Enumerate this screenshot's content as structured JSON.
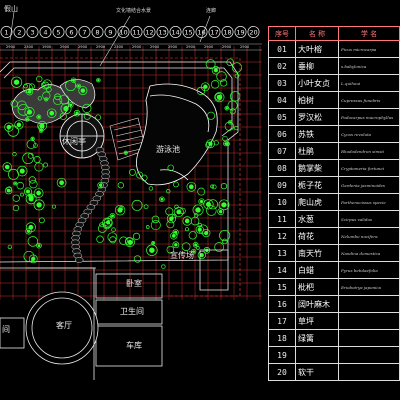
{
  "header": {
    "left_label": "假山",
    "center_label": "文化墙结合水景",
    "right_label": "连廊"
  },
  "axis": {
    "numbers": [
      "1",
      "2",
      "3",
      "4",
      "5",
      "6",
      "7",
      "8",
      "9",
      "10",
      "11",
      "12",
      "13",
      "14",
      "15",
      "16",
      "17",
      "18",
      "19",
      "20"
    ],
    "dimensions": [
      "2900",
      "2300",
      "1900",
      "2900",
      "2900",
      "2900",
      "2300",
      "2900",
      "2900",
      "2900",
      "2900",
      "2900",
      "2900",
      "2900"
    ]
  },
  "plan_labels": {
    "pavilion": "休闲亭",
    "pool": "游泳池",
    "plaza": "宣传场",
    "room1": "卧室",
    "room2": "卫生间",
    "living": "客厅",
    "garage": "车库",
    "corner": "间"
  },
  "legend": {
    "headers": [
      "序号",
      "名 称",
      "学 名"
    ],
    "rows": [
      {
        "no": "01",
        "name": "大叶榕",
        "sci": "Ficus microcarpa"
      },
      {
        "no": "02",
        "name": "垂柳",
        "sci": "s.babylonica"
      },
      {
        "no": "03",
        "name": "小叶女贞",
        "sci": "L.quihoui"
      },
      {
        "no": "04",
        "name": "柏树",
        "sci": "Cupressus funebris"
      },
      {
        "no": "05",
        "name": "罗汉松",
        "sci": "Podocarpus macrophyllus"
      },
      {
        "no": "06",
        "name": "苏铁",
        "sci": "Cycas revoluta"
      },
      {
        "no": "07",
        "name": "杜鹃",
        "sci": "Rhododendron simsii"
      },
      {
        "no": "08",
        "name": "鹅掌柴",
        "sci": "Cryptomeria fortunei"
      },
      {
        "no": "09",
        "name": "栀子花",
        "sci": "Gardenia jasminoides"
      },
      {
        "no": "10",
        "name": "爬山虎",
        "sci": "Parthenocissus specie"
      },
      {
        "no": "11",
        "name": "水葱",
        "sci": "Scirpus validus"
      },
      {
        "no": "12",
        "name": "荷花",
        "sci": "Nelumbo nucifera"
      },
      {
        "no": "13",
        "name": "南天竹",
        "sci": "Nandina domestica"
      },
      {
        "no": "14",
        "name": "白蜡",
        "sci": "Pyrus betulaefolia"
      },
      {
        "no": "15",
        "name": "枇杷",
        "sci": "Eriobotrya japonica"
      },
      {
        "no": "16",
        "name": "阔叶麻木",
        "sci": ""
      },
      {
        "no": "17",
        "name": "草坪",
        "sci": ""
      },
      {
        "no": "18",
        "name": "绿篱",
        "sci": ""
      },
      {
        "no": "19",
        "name": "",
        "sci": ""
      },
      {
        "no": "20",
        "name": "软干",
        "sci": ""
      }
    ]
  },
  "colors": {
    "background": "#000000",
    "grid": "#ff3b3b",
    "lines": "#e6e6e6",
    "vegetation": "#33ff33"
  }
}
